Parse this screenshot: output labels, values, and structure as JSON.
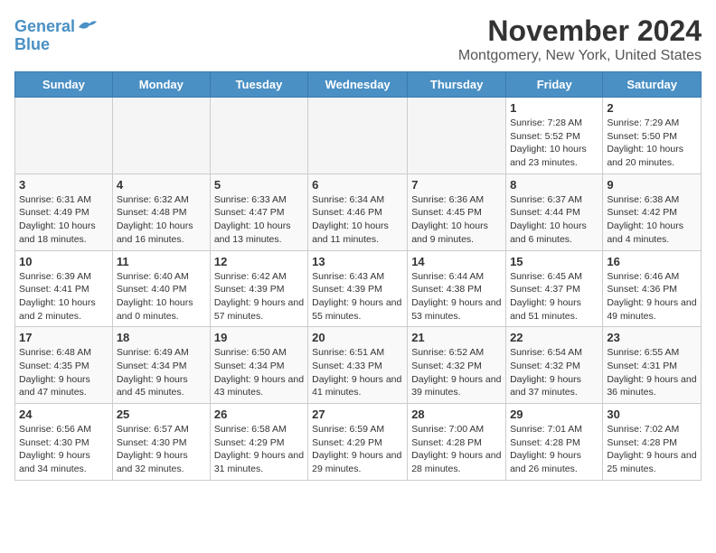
{
  "logo": {
    "line1": "General",
    "line2": "Blue"
  },
  "title": "November 2024",
  "location": "Montgomery, New York, United States",
  "days_of_week": [
    "Sunday",
    "Monday",
    "Tuesday",
    "Wednesday",
    "Thursday",
    "Friday",
    "Saturday"
  ],
  "weeks": [
    [
      {
        "day": "",
        "empty": true
      },
      {
        "day": "",
        "empty": true
      },
      {
        "day": "",
        "empty": true
      },
      {
        "day": "",
        "empty": true
      },
      {
        "day": "",
        "empty": true
      },
      {
        "day": "1",
        "sunrise": "Sunrise: 7:28 AM",
        "sunset": "Sunset: 5:52 PM",
        "daylight": "Daylight: 10 hours and 23 minutes."
      },
      {
        "day": "2",
        "sunrise": "Sunrise: 7:29 AM",
        "sunset": "Sunset: 5:50 PM",
        "daylight": "Daylight: 10 hours and 20 minutes."
      }
    ],
    [
      {
        "day": "3",
        "sunrise": "Sunrise: 6:31 AM",
        "sunset": "Sunset: 4:49 PM",
        "daylight": "Daylight: 10 hours and 18 minutes."
      },
      {
        "day": "4",
        "sunrise": "Sunrise: 6:32 AM",
        "sunset": "Sunset: 4:48 PM",
        "daylight": "Daylight: 10 hours and 16 minutes."
      },
      {
        "day": "5",
        "sunrise": "Sunrise: 6:33 AM",
        "sunset": "Sunset: 4:47 PM",
        "daylight": "Daylight: 10 hours and 13 minutes."
      },
      {
        "day": "6",
        "sunrise": "Sunrise: 6:34 AM",
        "sunset": "Sunset: 4:46 PM",
        "daylight": "Daylight: 10 hours and 11 minutes."
      },
      {
        "day": "7",
        "sunrise": "Sunrise: 6:36 AM",
        "sunset": "Sunset: 4:45 PM",
        "daylight": "Daylight: 10 hours and 9 minutes."
      },
      {
        "day": "8",
        "sunrise": "Sunrise: 6:37 AM",
        "sunset": "Sunset: 4:44 PM",
        "daylight": "Daylight: 10 hours and 6 minutes."
      },
      {
        "day": "9",
        "sunrise": "Sunrise: 6:38 AM",
        "sunset": "Sunset: 4:42 PM",
        "daylight": "Daylight: 10 hours and 4 minutes."
      }
    ],
    [
      {
        "day": "10",
        "sunrise": "Sunrise: 6:39 AM",
        "sunset": "Sunset: 4:41 PM",
        "daylight": "Daylight: 10 hours and 2 minutes."
      },
      {
        "day": "11",
        "sunrise": "Sunrise: 6:40 AM",
        "sunset": "Sunset: 4:40 PM",
        "daylight": "Daylight: 10 hours and 0 minutes."
      },
      {
        "day": "12",
        "sunrise": "Sunrise: 6:42 AM",
        "sunset": "Sunset: 4:39 PM",
        "daylight": "Daylight: 9 hours and 57 minutes."
      },
      {
        "day": "13",
        "sunrise": "Sunrise: 6:43 AM",
        "sunset": "Sunset: 4:39 PM",
        "daylight": "Daylight: 9 hours and 55 minutes."
      },
      {
        "day": "14",
        "sunrise": "Sunrise: 6:44 AM",
        "sunset": "Sunset: 4:38 PM",
        "daylight": "Daylight: 9 hours and 53 minutes."
      },
      {
        "day": "15",
        "sunrise": "Sunrise: 6:45 AM",
        "sunset": "Sunset: 4:37 PM",
        "daylight": "Daylight: 9 hours and 51 minutes."
      },
      {
        "day": "16",
        "sunrise": "Sunrise: 6:46 AM",
        "sunset": "Sunset: 4:36 PM",
        "daylight": "Daylight: 9 hours and 49 minutes."
      }
    ],
    [
      {
        "day": "17",
        "sunrise": "Sunrise: 6:48 AM",
        "sunset": "Sunset: 4:35 PM",
        "daylight": "Daylight: 9 hours and 47 minutes."
      },
      {
        "day": "18",
        "sunrise": "Sunrise: 6:49 AM",
        "sunset": "Sunset: 4:34 PM",
        "daylight": "Daylight: 9 hours and 45 minutes."
      },
      {
        "day": "19",
        "sunrise": "Sunrise: 6:50 AM",
        "sunset": "Sunset: 4:34 PM",
        "daylight": "Daylight: 9 hours and 43 minutes."
      },
      {
        "day": "20",
        "sunrise": "Sunrise: 6:51 AM",
        "sunset": "Sunset: 4:33 PM",
        "daylight": "Daylight: 9 hours and 41 minutes."
      },
      {
        "day": "21",
        "sunrise": "Sunrise: 6:52 AM",
        "sunset": "Sunset: 4:32 PM",
        "daylight": "Daylight: 9 hours and 39 minutes."
      },
      {
        "day": "22",
        "sunrise": "Sunrise: 6:54 AM",
        "sunset": "Sunset: 4:32 PM",
        "daylight": "Daylight: 9 hours and 37 minutes."
      },
      {
        "day": "23",
        "sunrise": "Sunrise: 6:55 AM",
        "sunset": "Sunset: 4:31 PM",
        "daylight": "Daylight: 9 hours and 36 minutes."
      }
    ],
    [
      {
        "day": "24",
        "sunrise": "Sunrise: 6:56 AM",
        "sunset": "Sunset: 4:30 PM",
        "daylight": "Daylight: 9 hours and 34 minutes."
      },
      {
        "day": "25",
        "sunrise": "Sunrise: 6:57 AM",
        "sunset": "Sunset: 4:30 PM",
        "daylight": "Daylight: 9 hours and 32 minutes."
      },
      {
        "day": "26",
        "sunrise": "Sunrise: 6:58 AM",
        "sunset": "Sunset: 4:29 PM",
        "daylight": "Daylight: 9 hours and 31 minutes."
      },
      {
        "day": "27",
        "sunrise": "Sunrise: 6:59 AM",
        "sunset": "Sunset: 4:29 PM",
        "daylight": "Daylight: 9 hours and 29 minutes."
      },
      {
        "day": "28",
        "sunrise": "Sunrise: 7:00 AM",
        "sunset": "Sunset: 4:28 PM",
        "daylight": "Daylight: 9 hours and 28 minutes."
      },
      {
        "day": "29",
        "sunrise": "Sunrise: 7:01 AM",
        "sunset": "Sunset: 4:28 PM",
        "daylight": "Daylight: 9 hours and 26 minutes."
      },
      {
        "day": "30",
        "sunrise": "Sunrise: 7:02 AM",
        "sunset": "Sunset: 4:28 PM",
        "daylight": "Daylight: 9 hours and 25 minutes."
      }
    ]
  ]
}
